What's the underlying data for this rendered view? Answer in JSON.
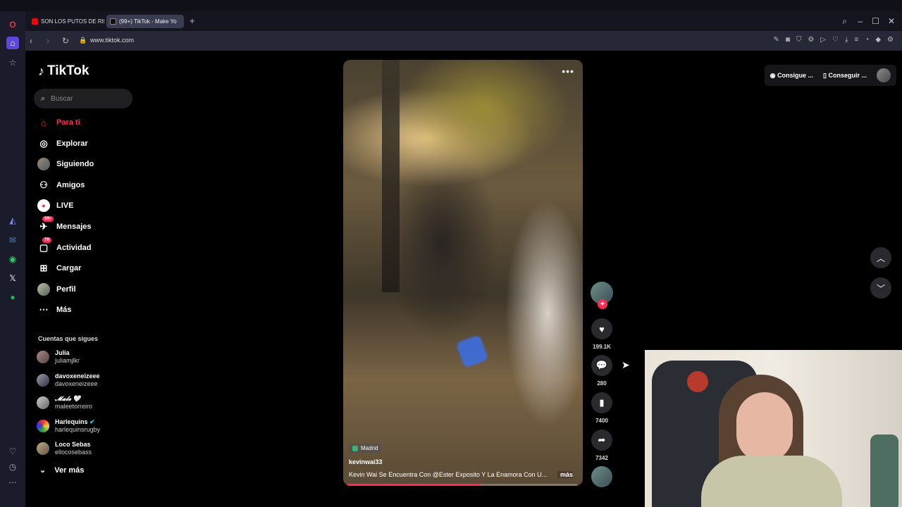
{
  "browser": {
    "tabs": [
      {
        "label": "SON LOS PUTOS DE RIBE",
        "active": false
      },
      {
        "label": "(99+) TikTok - Make Yo",
        "active": true
      }
    ],
    "url": "www.tiktok.com"
  },
  "tiktok": {
    "brand": "TikTok",
    "search_placeholder": "Buscar",
    "nav": [
      {
        "label": "Para ti",
        "icon": "home-icon",
        "active": true
      },
      {
        "label": "Explorar",
        "icon": "compass-icon"
      },
      {
        "label": "Siguiendo",
        "icon": "avatar"
      },
      {
        "label": "Amigos",
        "icon": "friends-icon"
      },
      {
        "label": "LIVE",
        "icon": "live-icon"
      },
      {
        "label": "Mensajes",
        "icon": "messages-icon",
        "badge": "99+"
      },
      {
        "label": "Actividad",
        "icon": "activity-icon",
        "badge": "79"
      },
      {
        "label": "Cargar",
        "icon": "upload-icon"
      },
      {
        "label": "Perfil",
        "icon": "avatar"
      },
      {
        "label": "Más",
        "icon": "more-icon"
      }
    ],
    "following_title": "Cuentas que sigues",
    "following": [
      {
        "name": "Julia",
        "user": "juliamjlkr"
      },
      {
        "name": "davoxeneizeee",
        "user": "davoxeneizeee"
      },
      {
        "name": "𝓜𝓪𝓵𝓮 🤍",
        "user": "maleetorreiro"
      },
      {
        "name": "Harlequins",
        "user": "harlequinsrugby",
        "verified": true
      },
      {
        "name": "Loco Sebas",
        "user": "ellocosebass"
      }
    ],
    "see_more": "Ver más",
    "top_right": {
      "btn1": "Consigue ...",
      "btn2": "Conseguir ..."
    },
    "video": {
      "location": "Madrid",
      "author": "kevinwai33",
      "description": "Kevin Wai Se Encuentra Con @Ester  Exposito Y La Enamora Con U...",
      "more": "más",
      "progress": 0.58
    },
    "actions": {
      "likes": "199.1K",
      "comments": "280",
      "saves": "7400",
      "shares": "7342"
    }
  }
}
